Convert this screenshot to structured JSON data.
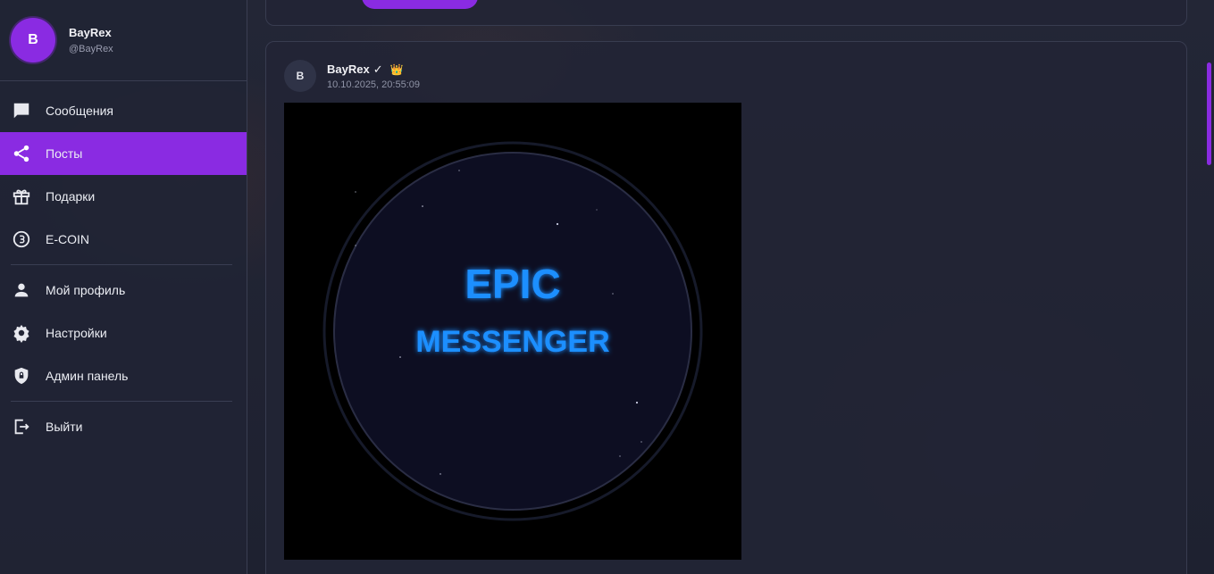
{
  "user": {
    "avatar_letter": "B",
    "name": "BayRex",
    "handle": "@BayRex"
  },
  "nav": {
    "messages": "Сообщения",
    "posts": "Посты",
    "gifts": "Подарки",
    "ecoin": "E-COIN",
    "profile": "Мой профиль",
    "settings": "Настройки",
    "admin": "Админ панель",
    "logout": "Выйти"
  },
  "nav_active": "posts",
  "post": {
    "avatar_letter": "B",
    "author": "BayRex",
    "verified_mark": "✓",
    "crown": "👑",
    "date": "10.10.2025, 20:55:09",
    "image": {
      "line1": "EPIC",
      "line2": "MESSENGER"
    }
  },
  "colors": {
    "accent": "#8a2be2",
    "image_text": "#1e8fff"
  }
}
